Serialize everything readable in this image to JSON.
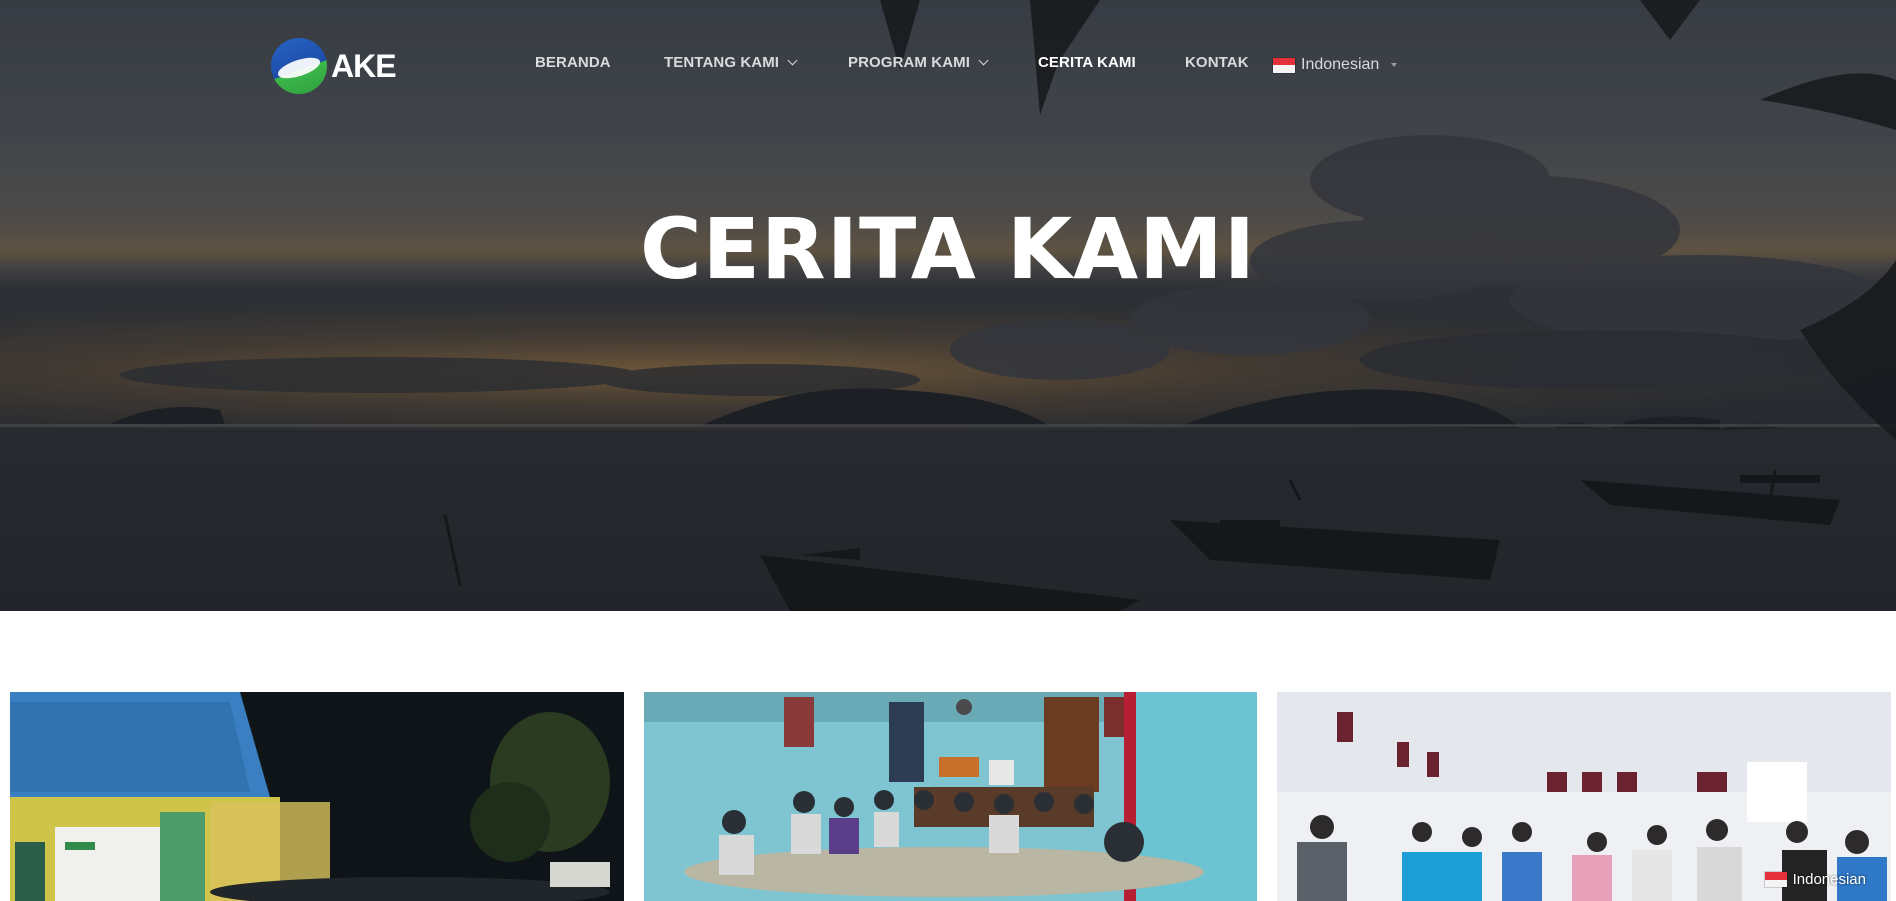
{
  "brand": {
    "logo_text": "AKE"
  },
  "nav": {
    "items": [
      {
        "label": "BERANDA",
        "has_dropdown": false,
        "active": false
      },
      {
        "label": "TENTANG KAMI",
        "has_dropdown": true,
        "active": false
      },
      {
        "label": "PROGRAM KAMI",
        "has_dropdown": true,
        "active": false
      },
      {
        "label": "CERITA KAMI",
        "has_dropdown": false,
        "active": true
      },
      {
        "label": "KONTAK",
        "has_dropdown": false,
        "active": false
      }
    ],
    "language": {
      "label": "Indonesian",
      "flag_icon": "indonesia-flag-icon"
    }
  },
  "hero": {
    "title": "CERITA KAMI"
  },
  "floating_language": {
    "label": "Indonesian",
    "flag_icon": "indonesia-flag-icon"
  },
  "colors": {
    "nav_text": "#d9dadc",
    "nav_active": "#ffffff",
    "hero_title": "#ffffff"
  }
}
